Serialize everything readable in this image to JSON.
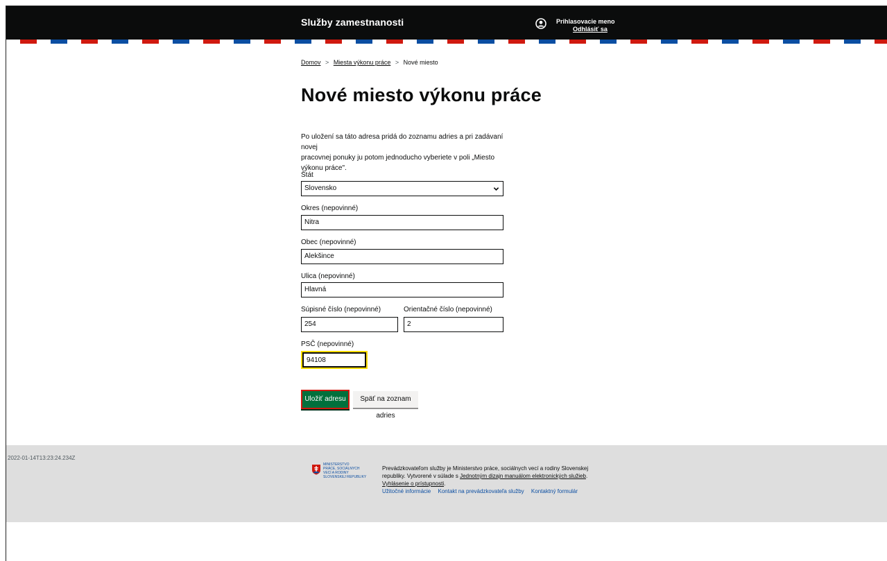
{
  "header": {
    "brand": "Služby zamestnanosti",
    "user_name": "Prihlasovacie meno",
    "logout": "Odhlásiť sa"
  },
  "breadcrumb": {
    "items": [
      "Domov",
      "Miesta výkonu práce",
      "Nové miesto"
    ],
    "separator": ">"
  },
  "page": {
    "title": "Nové miesto výkonu práce",
    "intro_line1": "Po uložení sa táto adresa pridá do zoznamu adries a pri zadávaní novej",
    "intro_line2": "pracovnej ponuky ju potom jednoducho vyberiete v poli „Miesto výkonu práce\"."
  },
  "form": {
    "stat": {
      "label": "Štát",
      "value": "Slovensko"
    },
    "okres": {
      "label": "Okres (nepovinné)",
      "value": "Nitra"
    },
    "obec": {
      "label": "Obec (nepovinné)",
      "value": "Alekšince"
    },
    "ulica": {
      "label": "Ulica (nepovinné)",
      "value": "Hlavná"
    },
    "supisne": {
      "label": "Súpisné číslo (nepovinné)",
      "value": "254"
    },
    "orientacne": {
      "label": "Orientačné číslo (nepovinné)",
      "value": "2"
    },
    "psc": {
      "label": "PSČ (nepovinné)",
      "value": "94108"
    }
  },
  "buttons": {
    "save": "Uložiť adresu",
    "back": "Späť na zoznam adries"
  },
  "footer": {
    "timestamp": "2022-01-14T13:23:24.234Z",
    "logo_lines": [
      "Ministerstvo",
      "práce, sociálnych",
      "vecí a rodiny",
      "Slovenskej republiky"
    ],
    "text_part1": "Prevádzkovateľom služby je Ministerstvo práce, sociálnych vecí a rodiny Slovenskej republiky. Vytvorené v súlade s ",
    "link_manual": "Jednotným dizajn manuálom elektronických služieb",
    "text_part2": ". ",
    "link_accessibility": "Vyhlásenie o prístupnosti",
    "text_part3": ".",
    "links": [
      "Užitočné informácie",
      "Kontakt na prevádzkovateľa služby",
      "Kontaktný formulár"
    ]
  },
  "colors": {
    "header_bg": "#0b0c0c",
    "primary_button": "#00703c",
    "focus": "#ffdd00",
    "flag_red": "#d0190f",
    "flag_blue": "#0b4ea2"
  }
}
